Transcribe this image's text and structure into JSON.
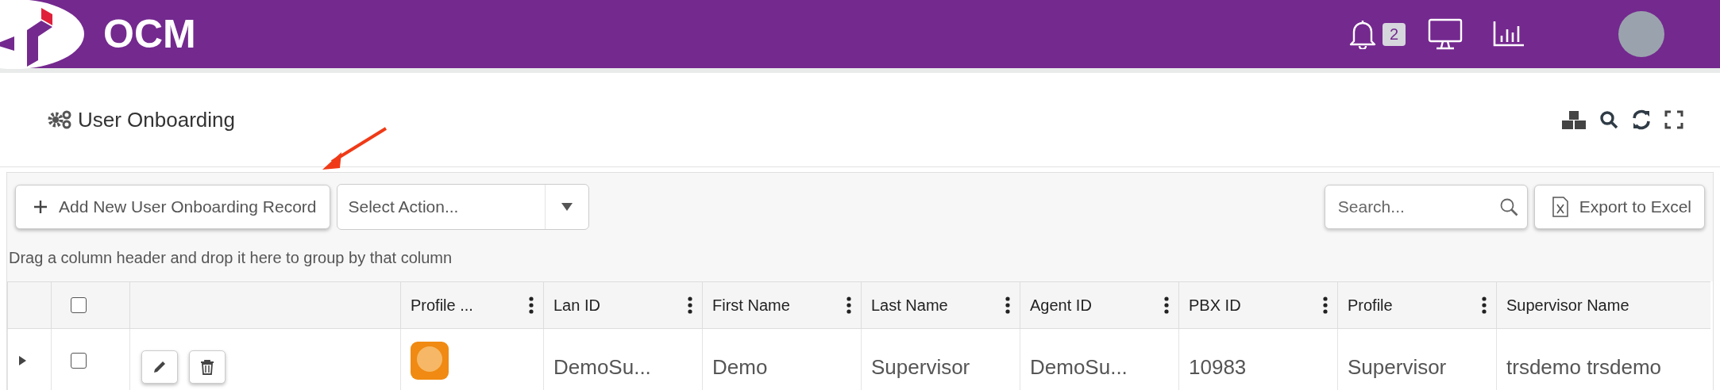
{
  "header": {
    "title": "OCM",
    "notification_count": "2"
  },
  "page": {
    "title": "User Onboarding"
  },
  "toolbar": {
    "add_button": "Add New User Onboarding Record",
    "action_select": {
      "placeholder": "Select Action..."
    },
    "search": {
      "placeholder": "Search..."
    },
    "export_button": "Export to Excel"
  },
  "group_hint": "Drag a column header and drop it here to group by that column",
  "table": {
    "all_checked": false,
    "columns": [
      {
        "label": "Profile ...",
        "menu": true
      },
      {
        "label": "Lan ID",
        "menu": true
      },
      {
        "label": "First Name",
        "menu": true
      },
      {
        "label": "Last Name",
        "menu": true
      },
      {
        "label": "Agent ID",
        "menu": true
      },
      {
        "label": "PBX ID",
        "menu": true
      },
      {
        "label": "Profile",
        "menu": true
      },
      {
        "label": "Supervisor Name",
        "menu": false
      }
    ],
    "rows": [
      {
        "expanded": false,
        "checked": false,
        "cells": [
          "",
          "DemoSu...",
          "Demo",
          "Supervisor",
          "DemoSu...",
          "10983",
          "Supervisor",
          "trsdemo trsdemo"
        ]
      }
    ]
  }
}
